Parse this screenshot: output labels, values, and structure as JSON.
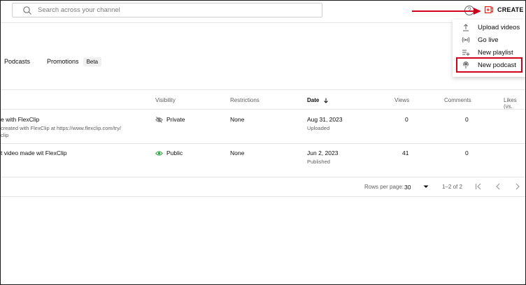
{
  "search": {
    "placeholder": "Search across your channel"
  },
  "header": {
    "create_label": "CREATE",
    "help_symbol": "?"
  },
  "tabs": [
    {
      "label": "Podcasts"
    },
    {
      "label": "Promotions"
    }
  ],
  "badge": {
    "label": "Beta"
  },
  "table": {
    "headers": {
      "visibility": "Visibility",
      "restrictions": "Restrictions",
      "date": "Date",
      "views": "Views",
      "comments": "Comments",
      "likes": "Likes (vs."
    },
    "rows": [
      {
        "title": "e with FlexClip",
        "desc1": "created with FlexClip at https://www.flexclip.com/try/",
        "desc2": "clip",
        "visibility": "Private",
        "restrictions": "None",
        "date": "Aug 31, 2023",
        "date_status": "Uploaded",
        "views": "0",
        "comments": "0"
      },
      {
        "title": "t video made wit FlexClip",
        "visibility": "Public",
        "restrictions": "None",
        "date": "Jun 2, 2023",
        "date_status": "Published",
        "views": "41",
        "comments": "0"
      }
    ]
  },
  "pagination": {
    "rows_per_page_label": "Rows per page:",
    "rows_per_page_value": "30",
    "range": "1–2 of 2"
  },
  "menu": {
    "items": [
      {
        "label": "Upload videos",
        "icon": "upload-icon"
      },
      {
        "label": "Go live",
        "icon": "live-icon"
      },
      {
        "label": "New playlist",
        "icon": "playlist-add-icon"
      },
      {
        "label": "New podcast",
        "icon": "podcast-icon"
      }
    ]
  },
  "colors": {
    "annotation_red": "#d0021b",
    "public_green": "#2ba640",
    "create_red": "#e62117"
  }
}
